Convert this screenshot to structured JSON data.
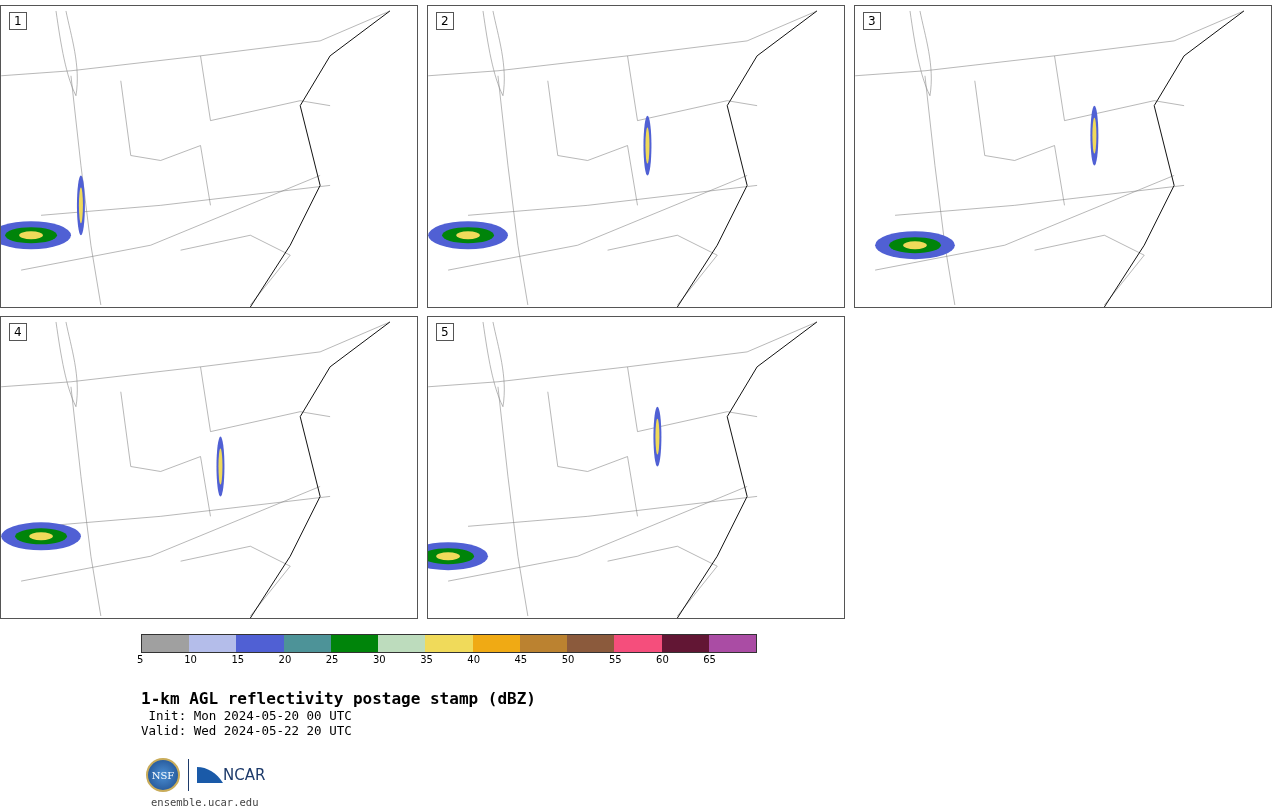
{
  "panels": [
    {
      "label": "1"
    },
    {
      "label": "2"
    },
    {
      "label": "3"
    },
    {
      "label": "4"
    },
    {
      "label": "5"
    }
  ],
  "colorbar": {
    "segments": [
      {
        "color": "#a0a0a0"
      },
      {
        "color": "#b4bdea"
      },
      {
        "color": "#5060d4"
      },
      {
        "color": "#4d9398"
      },
      {
        "color": "#00840a"
      },
      {
        "color": "#bddcbd"
      },
      {
        "color": "#f0da5a"
      },
      {
        "color": "#f0aa14"
      },
      {
        "color": "#bb8230"
      },
      {
        "color": "#8b5a3c"
      },
      {
        "color": "#f54e7c"
      },
      {
        "color": "#621634"
      },
      {
        "color": "#aa4ca4"
      }
    ],
    "ticks": [
      "5",
      "10",
      "15",
      "20",
      "25",
      "30",
      "35",
      "40",
      "45",
      "50",
      "55",
      "60",
      "65"
    ]
  },
  "title": "1-km AGL reflectivity postage stamp (dBZ)",
  "init": " Init: Mon 2024-05-20 00 UTC",
  "valid": "Valid: Wed 2024-05-22 20 UTC",
  "logo_text": "NCAR",
  "logo_nsf": "NSF",
  "footer": "ensemble.ucar.edu"
}
